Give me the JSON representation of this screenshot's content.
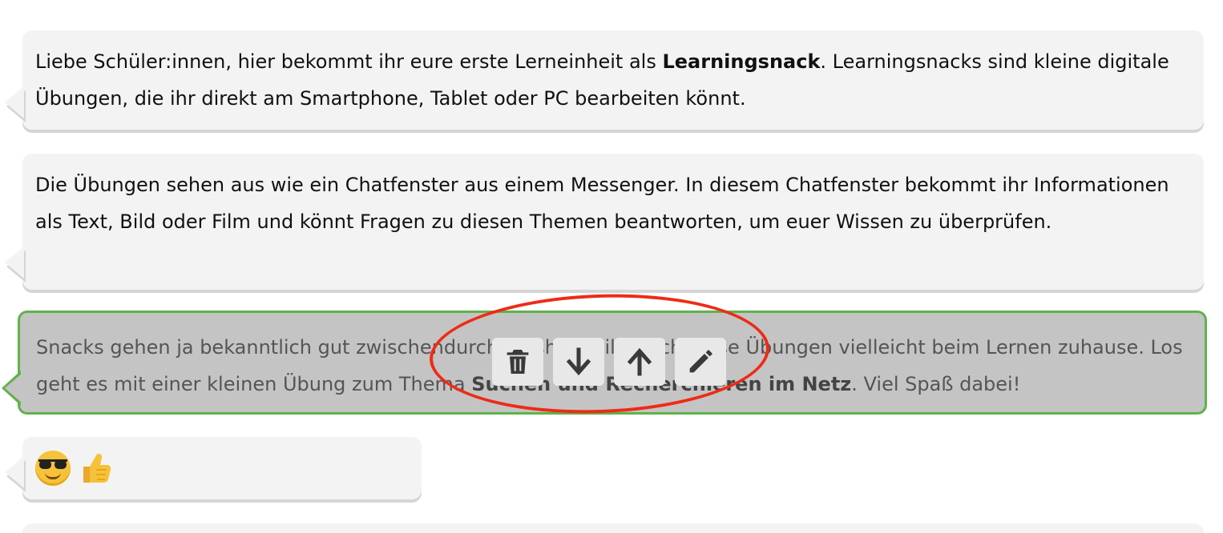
{
  "messages": [
    {
      "before": "Liebe Schüler:innen, hier bekommt ihr eure erste Lerneinheit als ",
      "bold": "Learningsnack",
      "after": ". Learningsnacks sind kleine digitale Übungen, die ihr direkt am Smartphone, Tablet oder PC bearbeiten könnt."
    },
    {
      "text": "Die Übungen sehen aus wie ein Chatfenster aus einem Messenger. In diesem Chatfenster bekommt ihr Informationen als Text, Bild oder Film und könnt Fragen zu diesen Themen beantworten, um euer Wissen zu überprüfen."
    },
    {
      "before": "Snacks gehen ja bekanntlich gut zwischendurch, deshalb hilft euch diese Übungen vielleicht beim Lernen zuhause. Los geht es mit einer kleinen Übung zum Thema ",
      "bold": "Suchen und Recherchieren im Netz",
      "after": ". Viel Spaß dabei!"
    },
    {
      "emojis": [
        "sunglasses-face-emoji",
        "thumbs-up-emoji"
      ]
    }
  ],
  "toolbar": {
    "buttons": [
      {
        "icon": "trash-icon"
      },
      {
        "icon": "arrow-down-icon"
      },
      {
        "icon": "arrow-up-icon"
      },
      {
        "icon": "pencil-icon"
      }
    ]
  },
  "colors": {
    "bubble_bg": "#f3f3f3",
    "selected_bg": "#c4c4c4",
    "selected_border": "#5fb34a",
    "annotation_ring": "#ee2b16"
  }
}
